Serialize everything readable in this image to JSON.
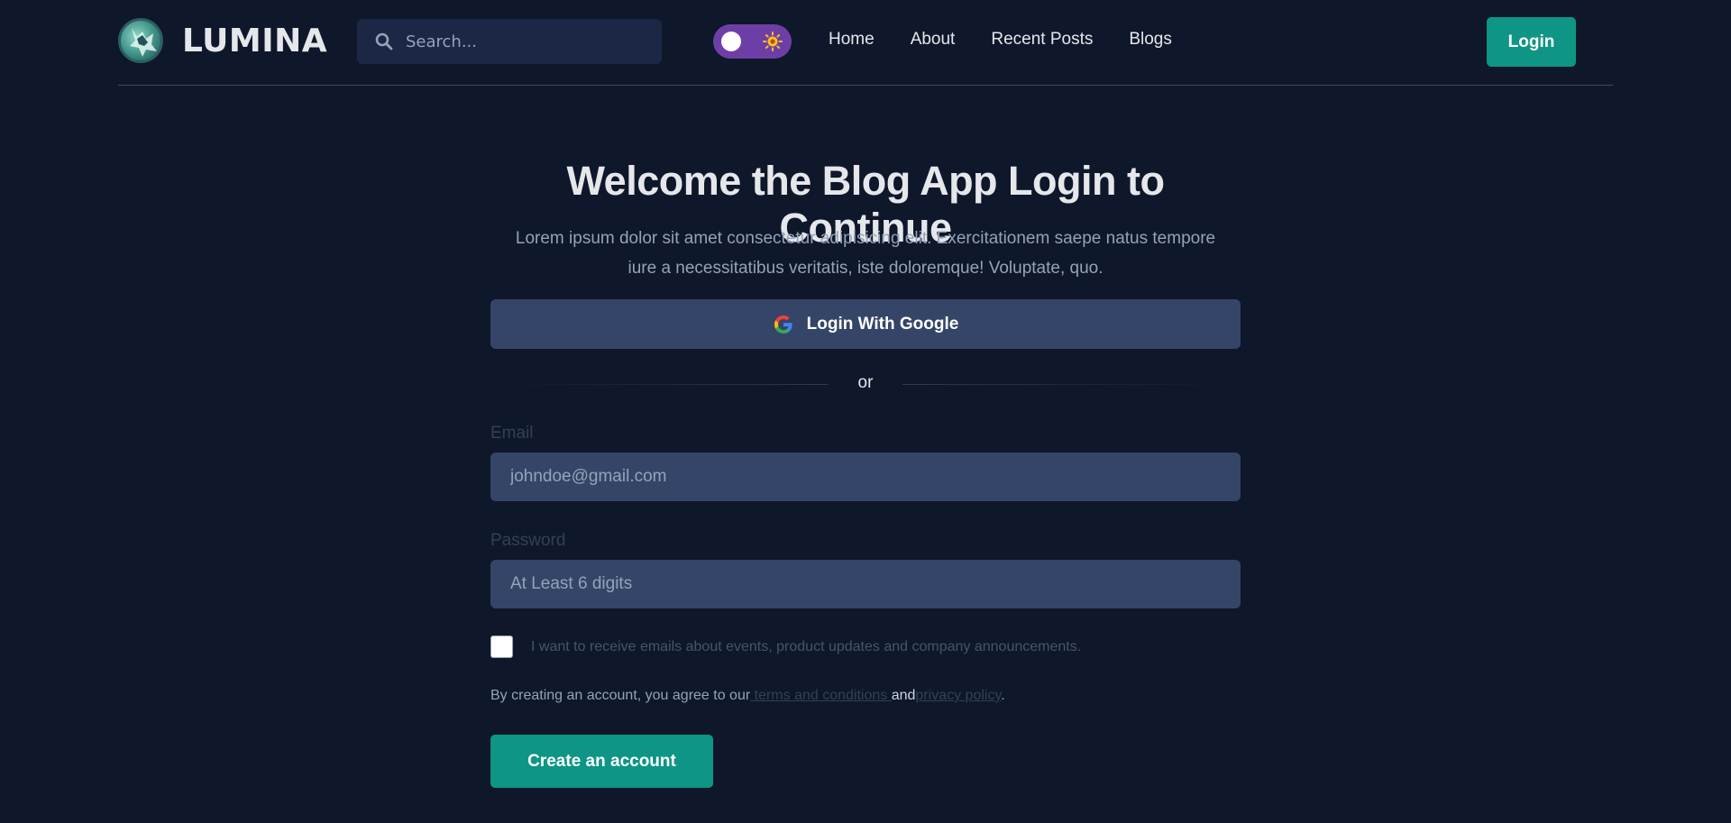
{
  "header": {
    "brand": "LUMINA",
    "search": {
      "placeholder": "Search..."
    },
    "nav": [
      "Home",
      "About",
      "Recent Posts",
      "Blogs"
    ],
    "login_label": "Login",
    "theme_icon": "sun-icon"
  },
  "main": {
    "title": "Welcome the Blog App Login to Continue",
    "subtitle": "Lorem ipsum dolor sit amet consectetur adipisicing elit. Exercitationem saepe natus tempore iure a necessitatibus veritatis, iste doloremque! Voluptate, quo.",
    "google_label": "Login With Google",
    "divider_text": "or",
    "email": {
      "label": "Email",
      "placeholder": "johndoe@gmail.com"
    },
    "password": {
      "label": "Password",
      "placeholder": "At Least 6 digits"
    },
    "checkbox_label": "I want to receive emails about events, product updates and company announcements.",
    "terms": {
      "prefix": "By creating an account, you agree to our",
      "terms_link": " terms and conditions ",
      "and": "and",
      "privacy_link": "privacy policy",
      "suffix": "."
    },
    "create_label": "Create an account"
  },
  "colors": {
    "background": "#0f172a",
    "accent": "#0e9585",
    "input_bg": "#354568",
    "toggle": "#6d3fa6"
  }
}
